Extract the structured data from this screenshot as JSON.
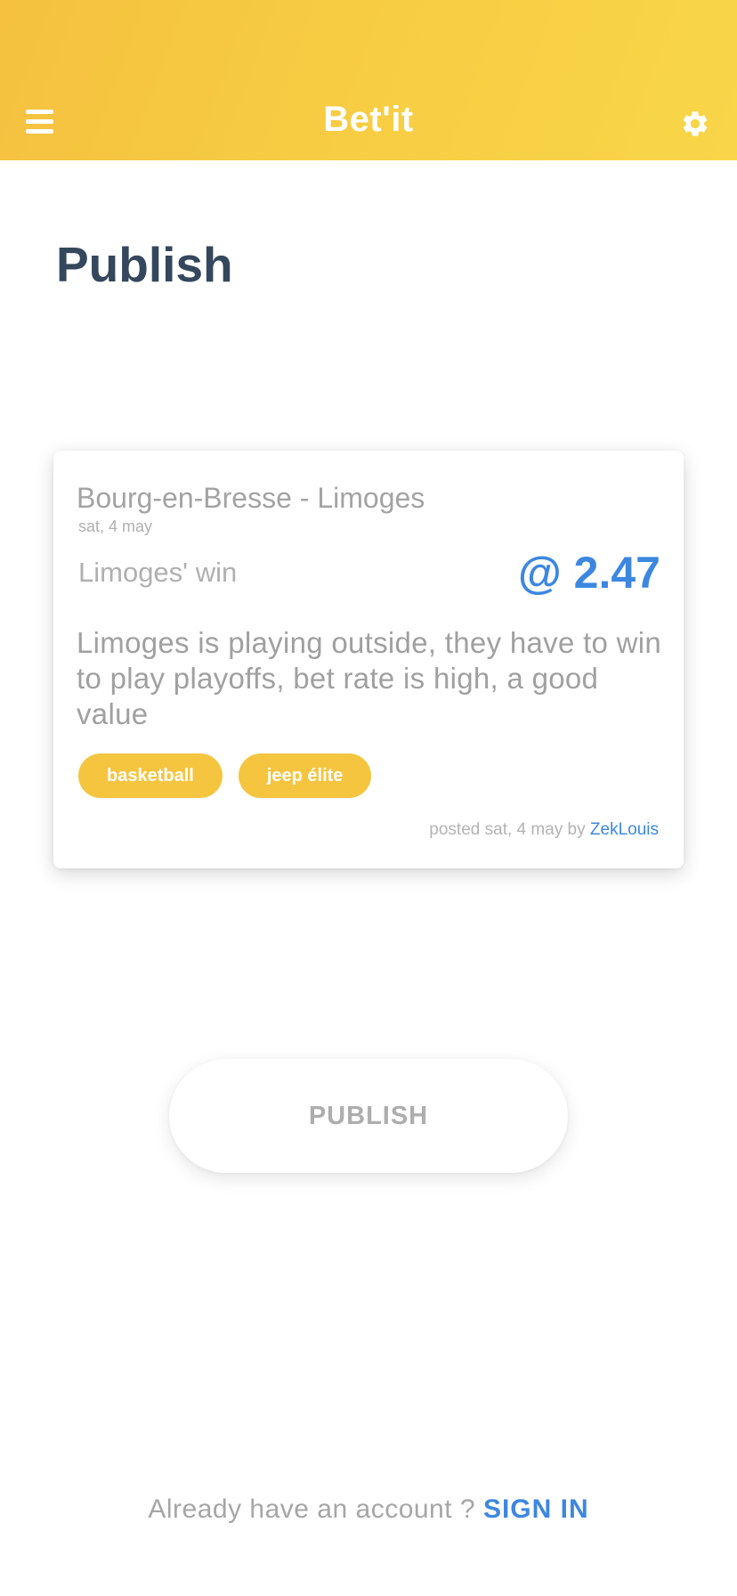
{
  "header": {
    "title": "Bet'it",
    "menu_icon": "hamburger-menu-icon",
    "settings_icon": "gear-icon",
    "background_color": "#f7c944",
    "text_color": "#ffffff"
  },
  "page": {
    "title": "Publish"
  },
  "bet_card": {
    "match": "Bourg-en-Bresse - Limoges",
    "match_date": "sat, 4 may",
    "pick": "Limoges' win",
    "odds": "@ 2.47",
    "description": "Limoges is playing outside, they have to win to play playoffs, bet rate is high, a good value",
    "tags": [
      "basketball",
      "jeep élite"
    ],
    "posted_prefix": "posted sat, 4 may by ",
    "author": "ZekLouis"
  },
  "actions": {
    "publish_label": "PUBLISH"
  },
  "footer": {
    "prompt": "Already have an account ? ",
    "signin_label": "SIGN IN"
  },
  "colors": {
    "accent": "#3d87e0",
    "tag": "#f5c540",
    "title": "#34475c"
  }
}
